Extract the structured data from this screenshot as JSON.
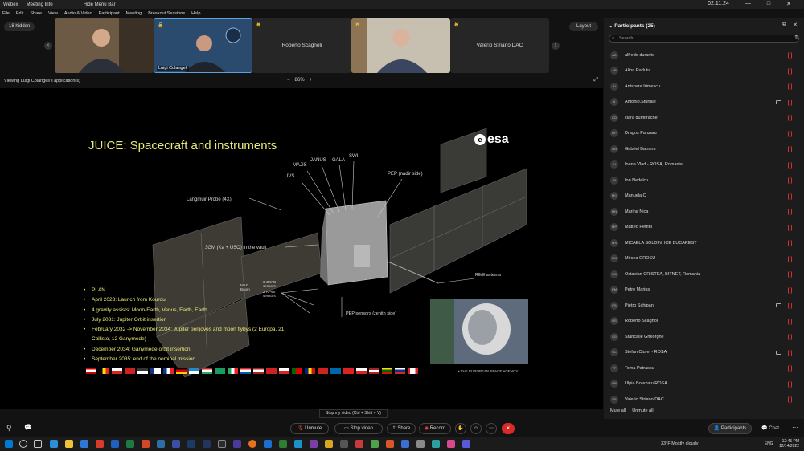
{
  "titlebar": {
    "app": "Webex",
    "meeting_info": "Meeting Info",
    "hide_menu": "Hide Menu Bar",
    "time": "02:11:24"
  },
  "menu": [
    "File",
    "Edit",
    "Share",
    "View",
    "Audio & Video",
    "Participant",
    "Meeting",
    "Breakout Sessions",
    "Help"
  ],
  "stage": {
    "hidden_label": "18 hidden",
    "layout_label": "Layout",
    "tiles": [
      {
        "name": "",
        "caption": ""
      },
      {
        "name": "",
        "caption": "Luigi Colangeli"
      },
      {
        "name": "Roberto Scagnoli",
        "caption": ""
      },
      {
        "name": "",
        "caption": ""
      },
      {
        "name": "Valerio Striano DAC",
        "caption": ""
      }
    ],
    "viewing": "Viewing Luigi Colangeli's application(s)",
    "zoom": "86%"
  },
  "slide": {
    "title": "JUICE: Spacecraft and instruments",
    "logo": "esa",
    "labels": {
      "uvs": "UVS",
      "majis": "MAJIS",
      "janus": "JANUS",
      "gala": "GALA",
      "swi": "SWI",
      "pep_nadir": "PEP (nadir side)",
      "langmuir": "Langmuir Probe (4X)",
      "tgm": "3GM (Ka + USO) in the vault",
      "mag": "MAG Boom",
      "jmag": "3 JMAG sensors",
      "rpwi": "2 RPWI sensors",
      "rime": "RIME antenna",
      "pep_zenith": "PEP sensors (zenith side)",
      "agency": "• THE EUROPEAN SPACE AGENCY"
    },
    "plan": [
      "PLAN",
      "April 2023: Launch from Kourou",
      "4 gravity assists: Moon-Earth, Venus, Earth, Earth",
      "July 2031: Jupiter Orbit insertion",
      "February 2032 -> November 2034: Jupiter perijoves and moon flybys (2 Europa, 21 Callisto, 12 Ganymede)",
      "December 2034: Ganymede orbit insertion",
      "September 2035: end of the nominal mission"
    ]
  },
  "participants": {
    "header": "Participants (25)",
    "search_placeholder": "Search",
    "list": [
      {
        "initials": "AD",
        "name": "alfredo durante",
        "video": false
      },
      {
        "initials": "AR",
        "name": "Alina Radutu",
        "video": false
      },
      {
        "initials": "AI",
        "name": "Anisoara Irimescu",
        "video": false
      },
      {
        "initials": "A",
        "name": "Antonio.Sturiale",
        "video": true
      },
      {
        "initials": "CD",
        "name": "clara dumitrache",
        "video": false
      },
      {
        "initials": "DP",
        "name": "Dragos Panzaru",
        "video": false
      },
      {
        "initials": "GB",
        "name": "Gabriel Batranu",
        "video": false
      },
      {
        "initials": "IV",
        "name": "Ioana Vlad - ROSA, Romania",
        "video": false
      },
      {
        "initials": "IN",
        "name": "Ion Nedelcu",
        "video": false
      },
      {
        "initials": "MC",
        "name": "Manuela C",
        "video": false
      },
      {
        "initials": "MN",
        "name": "Marina Nica",
        "video": false
      },
      {
        "initials": "MP",
        "name": "Matteo Petrini",
        "video": false
      },
      {
        "initials": "MS",
        "name": "MICAELA SOLDINI ICE BUCAREST",
        "video": false
      },
      {
        "initials": "MG",
        "name": "Mircea GROSU",
        "video": false
      },
      {
        "initials": "OC",
        "name": "Octavian CRISTEA, BITNET, Romania",
        "video": false
      },
      {
        "initials": "PM",
        "name": "Petre Marius",
        "video": false
      },
      {
        "initials": "PS",
        "name": "Pietro Schipani",
        "video": true
      },
      {
        "initials": "RS",
        "name": "Roberto Scagnoli",
        "video": false
      },
      {
        "initials": "SG",
        "name": "Stancalie Gheorghe",
        "video": false
      },
      {
        "initials": "SC",
        "name": "Stefan Ciurel - ROSA",
        "video": true
      },
      {
        "initials": "TP",
        "name": "Toma Patrascu",
        "video": false
      },
      {
        "initials": "UR",
        "name": "Ulpia Botezatu ROSA",
        "video": false
      },
      {
        "initials": "VS",
        "name": "Valerio Striano DAC",
        "video": false
      }
    ],
    "mute_all": "Mute all",
    "unmute_all": "Unmute all"
  },
  "controls": {
    "tooltip": "Stop my video (Ctrl + Shift + V)",
    "unmute": "Unmute",
    "stop_video": "Stop video",
    "share": "Share",
    "record": "Record",
    "participants": "Participants",
    "chat": "Chat"
  },
  "taskbar": {
    "weather": "33°F  Mostly cloudy",
    "lang": "ENG",
    "time": "12:45 PM",
    "date": "12/14/2022"
  }
}
